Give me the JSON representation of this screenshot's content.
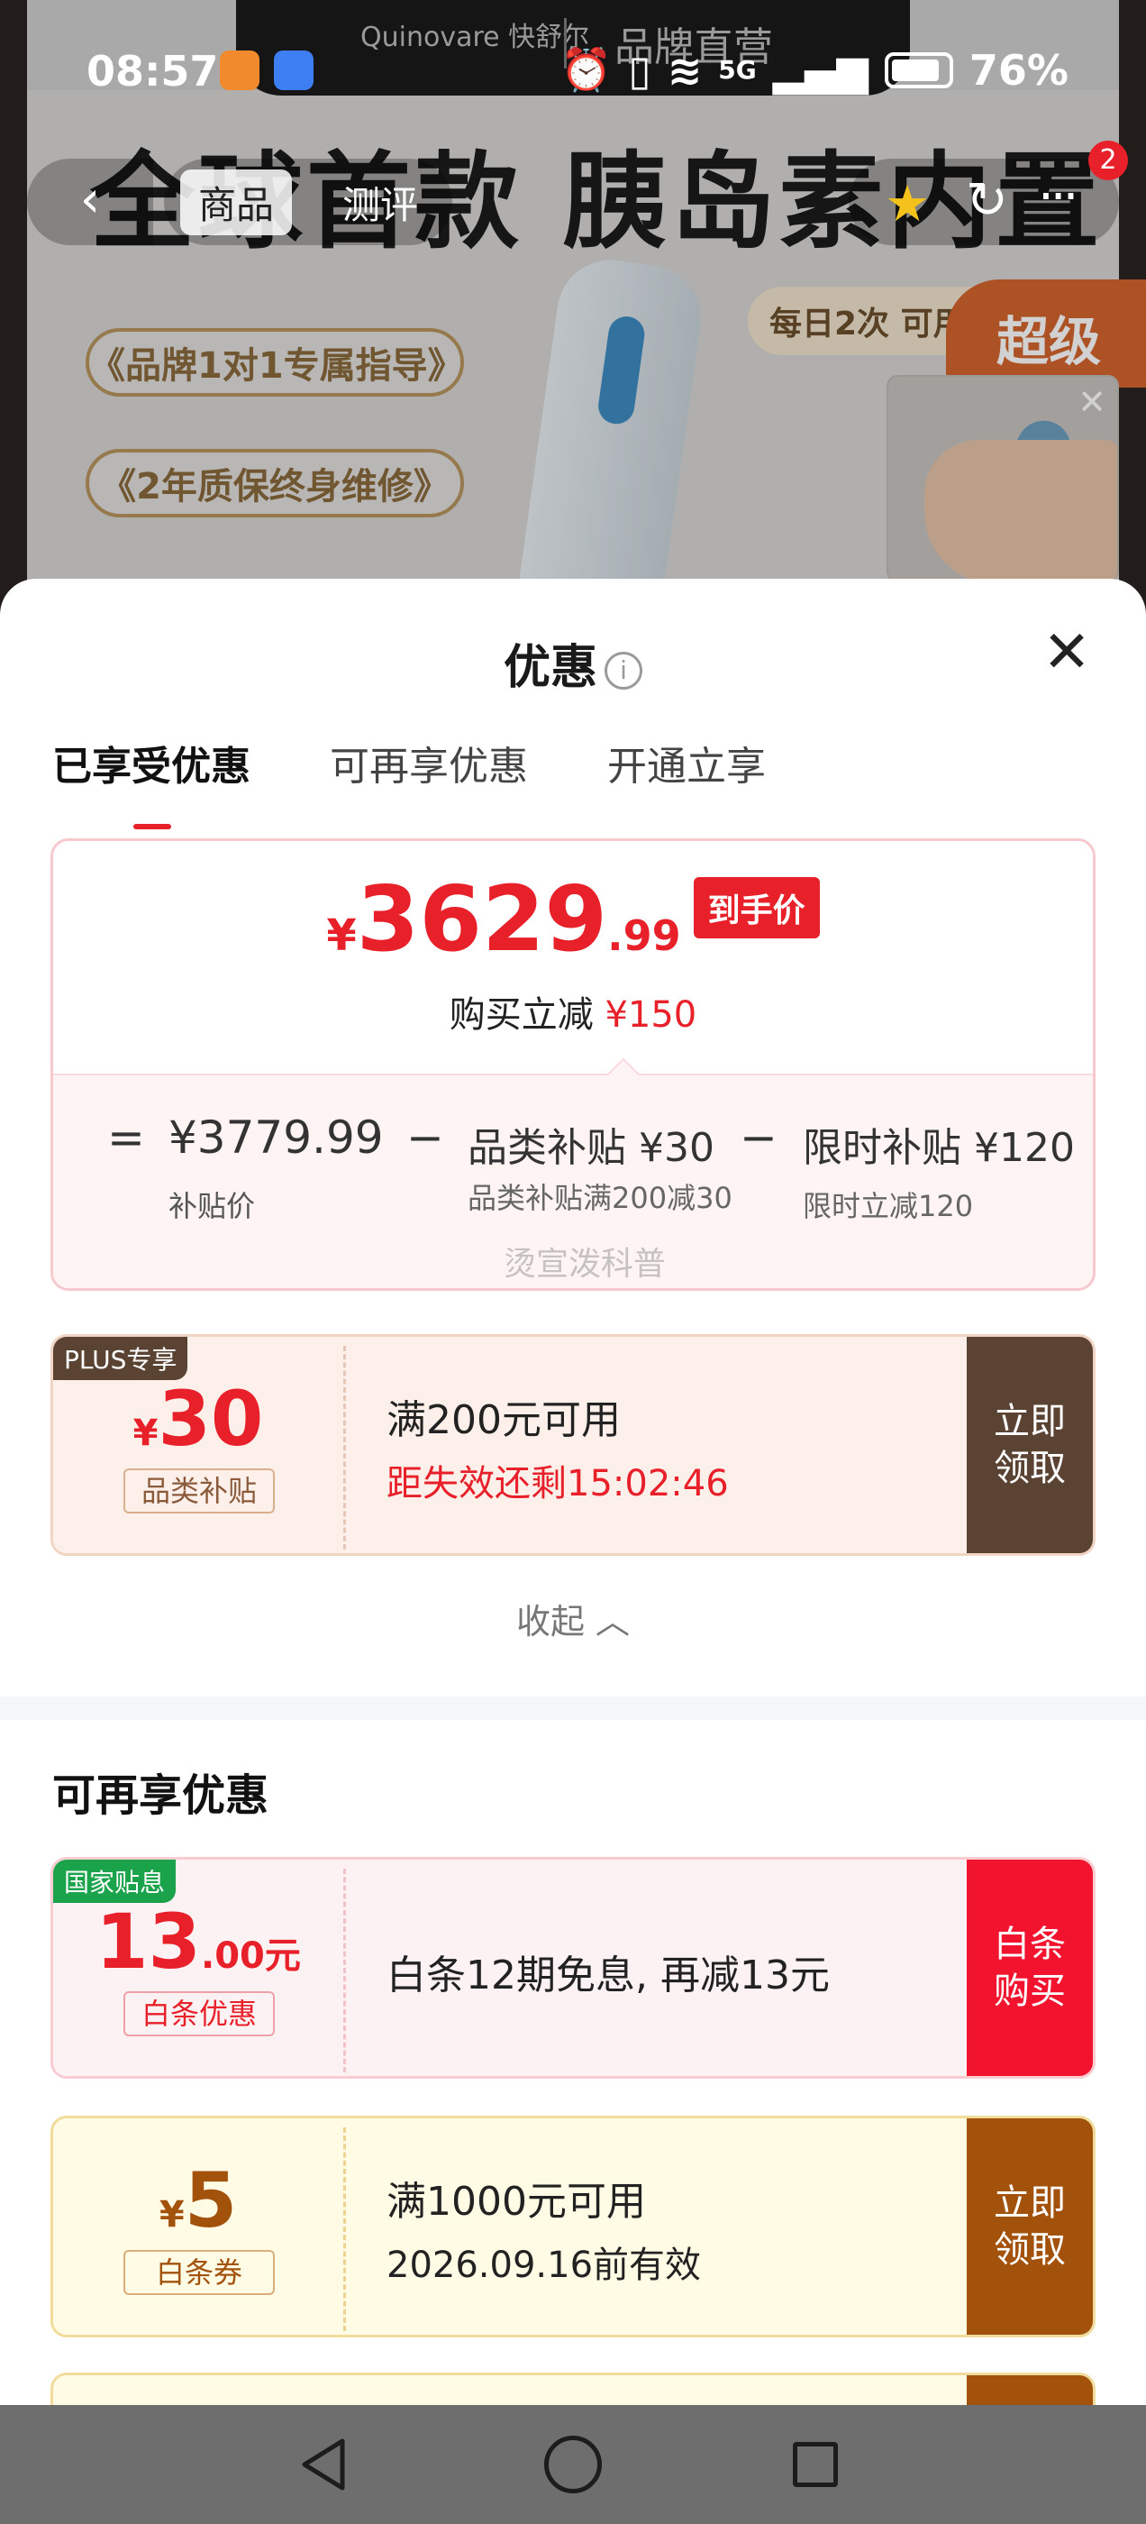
{
  "status_bar": {
    "time": "08:57",
    "battery": "76%",
    "network": "5G",
    "notch_brand": "Quinovare 快舒尔",
    "notch_title": "品牌直营"
  },
  "product_page": {
    "headline": "全球首款 胰岛素内置",
    "pill_1": "《品牌1对1专属指导》",
    "pill_2": "《2年质保终身维修》",
    "daily": "每日2次  可用",
    "super": "超级",
    "nav_tabs": [
      "商品",
      "测评"
    ],
    "badge_count": "2"
  },
  "sheet": {
    "title": "优惠",
    "tabs": [
      {
        "label": "已享受优惠",
        "active": true
      },
      {
        "label": "可再享优惠",
        "active": false
      },
      {
        "label": "开通立享",
        "active": false
      }
    ],
    "price": {
      "yen": "¥",
      "integer": "3629",
      "decimal": ".99",
      "tag": "到手价",
      "sub_prefix": "购买立减",
      "sub_amount": "¥150"
    },
    "calc": {
      "equals": "=",
      "base_value": "¥3779.99",
      "base_label": "补贴价",
      "minus": "−",
      "item1_value": "品类补贴 ¥30",
      "item1_label": "品类补贴满200减30",
      "item2_value": "限时补贴 ¥120",
      "item2_label": "限时立减120",
      "watermark": "烫宣泼科普"
    },
    "coupon_plus": {
      "ribbon": "PLUS专享",
      "yen": "¥",
      "amount": "30",
      "kind": "品类补贴",
      "line1": "满200元可用",
      "line2": "距失效还剩15:02:46",
      "button": "立即领取"
    },
    "collapse": "收起",
    "section_title": "可再享优惠",
    "coupon_baitiao": {
      "ribbon": "国家贴息",
      "amount": "13",
      "decimal": ".00元",
      "kind": "白条优惠",
      "line1": "白条12期免息, 再减13元",
      "button": "白条购买"
    },
    "coupon_voucher": {
      "yen": "¥",
      "amount": "5",
      "kind": "白条券",
      "line1": "满1000元可用",
      "line2": "2026.09.16前有效",
      "button": "立即领取"
    }
  },
  "colors": {
    "accent_red": "#e8202a",
    "plus_brown": "#5a4332",
    "voucher_brown": "#a3520c",
    "gov_green": "#1aa34a"
  }
}
